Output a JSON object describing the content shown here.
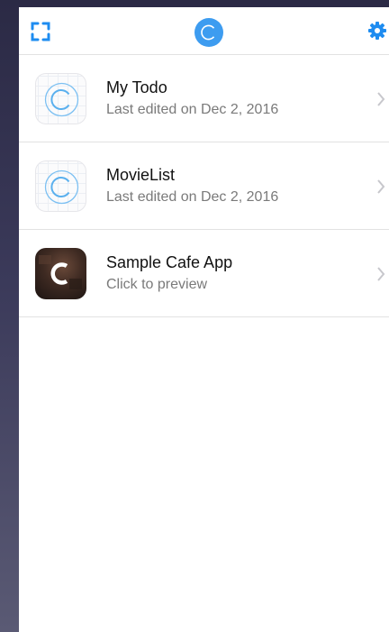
{
  "header": {
    "left_icon": "scan-frame-icon",
    "center_icon": "app-logo-icon",
    "right_icon": "gear-icon",
    "accent_color": "#1e8cf0",
    "logo_color": "#3d9cf0"
  },
  "apps": [
    {
      "title": "My Todo",
      "subtitle": "Last edited on Dec 2, 2016",
      "icon": "blueprint-c-icon"
    },
    {
      "title": "MovieList",
      "subtitle": "Last edited on Dec 2, 2016",
      "icon": "blueprint-c-icon"
    },
    {
      "title": "Sample Cafe App",
      "subtitle": "Click to preview",
      "icon": "cafe-c-icon"
    }
  ]
}
